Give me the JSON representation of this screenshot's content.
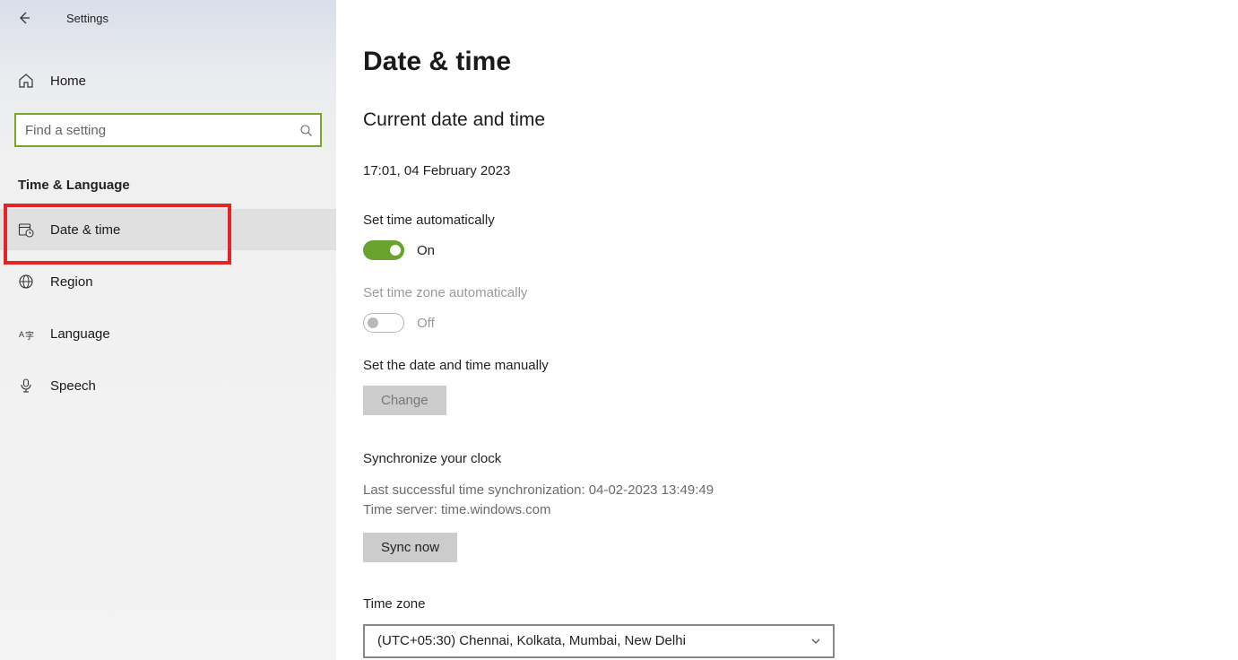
{
  "header": {
    "title": "Settings"
  },
  "sidebar": {
    "home_label": "Home",
    "search_placeholder": "Find a setting",
    "category": "Time & Language",
    "items": [
      {
        "label": "Date & time"
      },
      {
        "label": "Region"
      },
      {
        "label": "Language"
      },
      {
        "label": "Speech"
      }
    ]
  },
  "main": {
    "title": "Date & time",
    "subtitle": "Current date and time",
    "current_datetime": "17:01, 04 February 2023",
    "set_time_auto": {
      "label": "Set time automatically",
      "state": "On"
    },
    "set_tz_auto": {
      "label": "Set time zone automatically",
      "state": "Off"
    },
    "set_manual": {
      "label": "Set the date and time manually",
      "button": "Change"
    },
    "sync": {
      "heading": "Synchronize your clock",
      "last_sync": "Last successful time synchronization: 04-02-2023 13:49:49",
      "server": "Time server: time.windows.com",
      "button": "Sync now"
    },
    "timezone": {
      "heading": "Time zone",
      "selected": "(UTC+05:30) Chennai, Kolkata, Mumbai, New Delhi"
    }
  }
}
